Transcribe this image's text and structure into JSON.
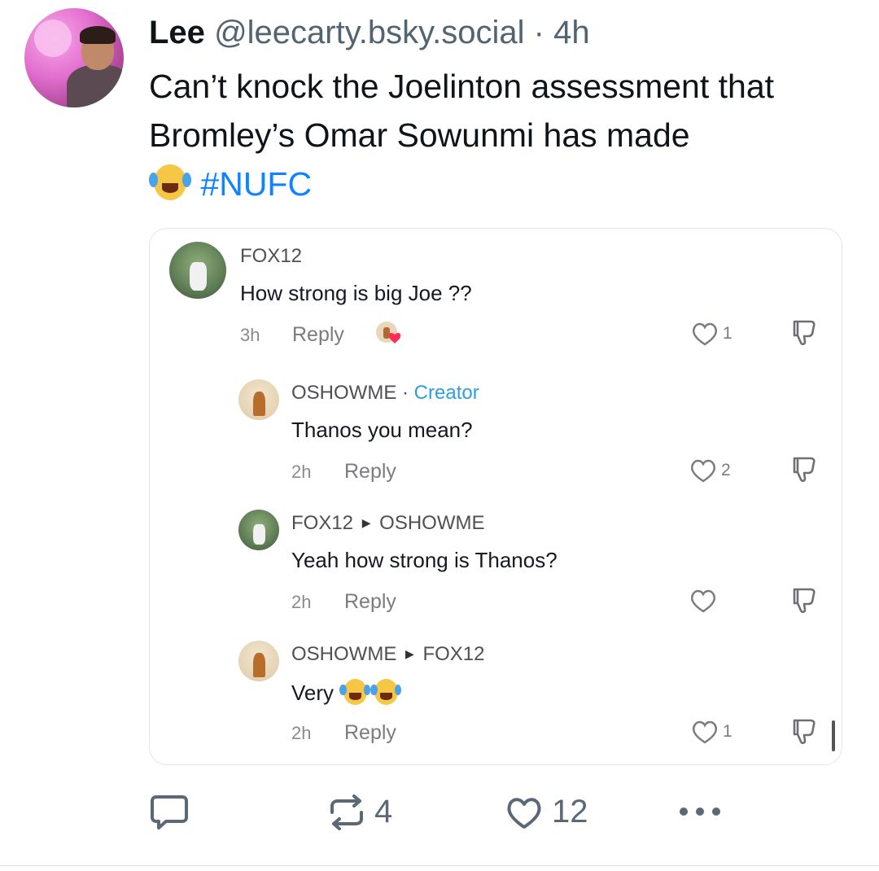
{
  "post": {
    "author_name": "Lee",
    "handle": "@leecarty.bsky.social",
    "separator": "·",
    "time": "4h",
    "text": "Can’t knock the Joelinton assessment that Bromley’s Omar Sowunmi has made",
    "hashtag": "#NUFC"
  },
  "comments": [
    {
      "username": "FOX12",
      "text": "How strong is big Joe ??",
      "time": "3h",
      "reply_label": "Reply",
      "likes": "1"
    },
    {
      "username": "OSHOWME",
      "separator": "·",
      "badge": "Creator",
      "text": "Thanos you mean?",
      "time": "2h",
      "reply_label": "Reply",
      "likes": "2"
    },
    {
      "username": "FOX12",
      "reply_to": "OSHOWME",
      "text": "Yeah how strong is Thanos?",
      "time": "2h",
      "reply_label": "Reply",
      "likes": ""
    },
    {
      "username": "OSHOWME",
      "reply_to": "FOX12",
      "text": "Very",
      "time": "2h",
      "reply_label": "Reply",
      "likes": "1"
    }
  ],
  "actions": {
    "reposts": "4",
    "likes": "12"
  },
  "colors": {
    "hashtag": "#1083fe",
    "creator_badge": "#2d9fd9",
    "secondary_text": "#536471"
  },
  "icons": [
    "laughing-tears-emoji",
    "heart-icon",
    "dislike-icon",
    "comment-icon",
    "repost-icon",
    "more-icon"
  ]
}
